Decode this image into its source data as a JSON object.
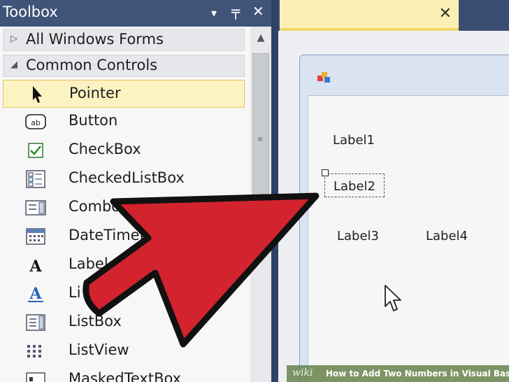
{
  "toolbox": {
    "title": "Toolbox",
    "controls": {
      "dropdown": "▾",
      "pin": "╤",
      "close": "✕"
    },
    "categories": [
      {
        "label": "All Windows Forms",
        "expanded": false
      },
      {
        "label": "Common Controls",
        "expanded": true
      }
    ],
    "items": [
      {
        "label": "Pointer",
        "icon": "pointer-icon",
        "selected": true
      },
      {
        "label": "Button",
        "icon": "button-icon"
      },
      {
        "label": "CheckBox",
        "icon": "checkbox-icon"
      },
      {
        "label": "CheckedListBox",
        "icon": "checked-listbox-icon"
      },
      {
        "label": "Combo",
        "icon": "combobox-icon"
      },
      {
        "label": "DateTimeP",
        "icon": "datetime-picker-icon"
      },
      {
        "label": "Label",
        "icon": "label-icon"
      },
      {
        "label": "Li",
        "icon": "linklabel-icon"
      },
      {
        "label": "ListBox",
        "icon": "listbox-icon"
      },
      {
        "label": "ListView",
        "icon": "listview-icon"
      },
      {
        "label": "MaskedTextBox",
        "icon": "masked-textbox-icon"
      }
    ]
  },
  "designer": {
    "tab_close": "✕",
    "labels": [
      "Label1",
      "Label2",
      "Label3",
      "Label4"
    ]
  },
  "watermark": {
    "wiki": "wiki",
    "text": "How to Add Two Numbers in Visual Basic"
  },
  "colors": {
    "header_bg": "#3f5478",
    "selection": "#fdf2c2",
    "tab_active": "#fbefb5",
    "arrow_red": "#d2232f"
  }
}
